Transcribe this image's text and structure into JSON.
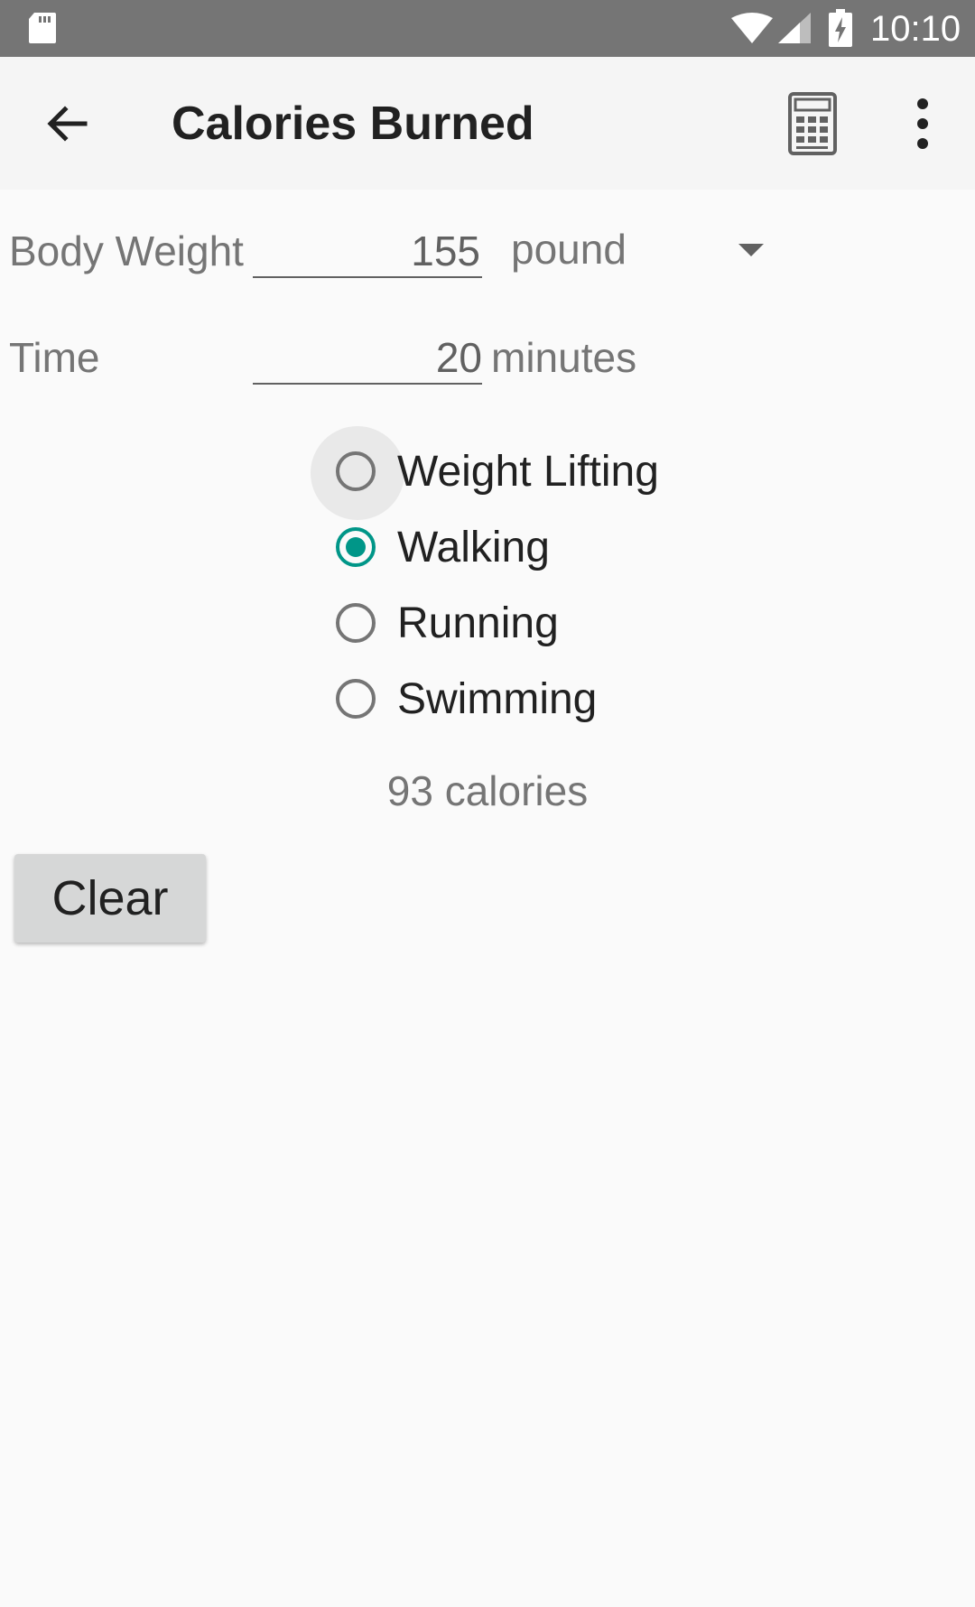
{
  "status_bar": {
    "time": "10:10",
    "icons": [
      "sd-card-icon",
      "wifi-icon",
      "cell-signal-icon",
      "battery-charging-icon"
    ]
  },
  "toolbar": {
    "title": "Calories Burned",
    "icons": [
      "back-arrow-icon",
      "calculator-icon",
      "more-vert-icon"
    ]
  },
  "form": {
    "body_weight": {
      "label": "Body Weight",
      "value": "155",
      "unit": "pound"
    },
    "time": {
      "label": "Time",
      "value": "20",
      "suffix": "minutes"
    }
  },
  "activities": {
    "options": [
      {
        "label": "Weight Lifting",
        "selected": false,
        "focused": true
      },
      {
        "label": "Walking",
        "selected": true,
        "focused": false
      },
      {
        "label": "Running",
        "selected": false,
        "focused": false
      },
      {
        "label": "Swimming",
        "selected": false,
        "focused": false
      }
    ]
  },
  "result": {
    "text": "93 calories"
  },
  "actions": {
    "clear_label": "Clear"
  },
  "colors": {
    "status_bar": "#757575",
    "toolbar": "#f5f5f5",
    "background": "#fafafa",
    "accent": "#009688",
    "button": "#d6d7d7"
  }
}
